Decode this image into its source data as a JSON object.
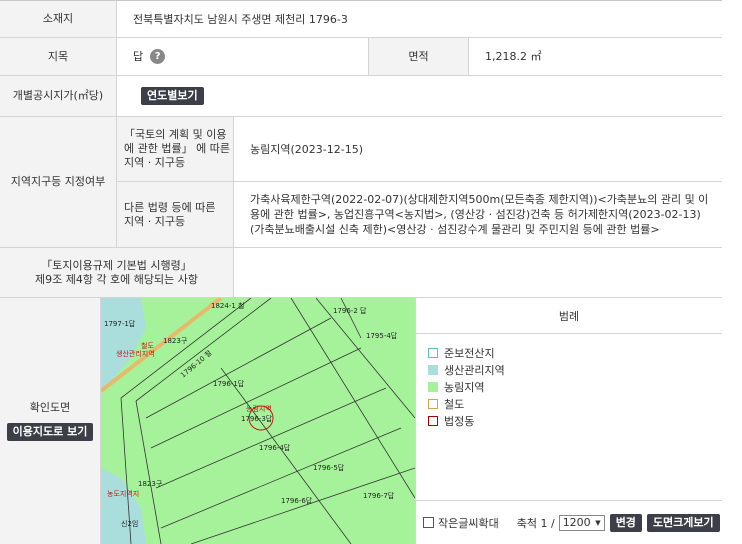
{
  "location": {
    "label": "소재지",
    "value": "전북특별자치도 남원시 주생면 제천리 1796-3"
  },
  "jimok": {
    "label": "지목",
    "value": "답",
    "help": "?"
  },
  "area": {
    "label": "면적",
    "value": "1,218.2 ㎡"
  },
  "price": {
    "label": "개별공시지가(㎡당)",
    "button": "연도별보기"
  },
  "zones": {
    "label": "지역지구등 지정여부",
    "national_label": "「국토의 계획 및 이용\n에 관한 법률」 에 따른\n지역 · 지구등",
    "national_value": "농림지역(2023-12-15)",
    "other_label": "다른 법령 등에 따른\n지역 · 지구등",
    "other_value": "가축사육제한구역(2022-02-07)(상대제한지역500m(모든축종 제한지역))<가축분뇨의 관리 및 이용에 관한 법률>, 농업진흥구역<농지법>, (영산강 · 섬진강)건축 등 허가제한지역(2023-02-13)(가축분뇨배출시설 신축 제한)<영산강 · 섬진강수계 물관리 및 주민지원 등에 관한 법률>"
  },
  "regulation": {
    "label": "「토지이용규제 기본법 시행령」\n제9조 제4항 각 호에 해당되는 사항",
    "value": ""
  },
  "map": {
    "label": "확인도면",
    "button": "이용지도로 보기",
    "labels": {
      "p1824": "1824-1 철",
      "p1797": "1797-1답",
      "p1823": "1823구",
      "rail": "철도",
      "prod_zone": "생산관리지역",
      "p1796_10": "1796-10 철",
      "p1796_1": "1796-1답",
      "p1796_2": "1796-2 답",
      "p1795_4": "1795-4답",
      "farm_zone": "농림지역",
      "p1796_3": "1796-3답",
      "p1796_4": "1796-4답",
      "p1796_5": "1796-5답",
      "p1796_6": "1796-6답",
      "p1796_7": "1796-7답",
      "p1822": "신2임",
      "dong": "농도지역지"
    },
    "colors": {
      "farm": "#a6f29a",
      "prod": "#a9dedd",
      "rail": "#e8b86b",
      "boundary": "#c11"
    }
  },
  "legend": {
    "title": "범례",
    "items": [
      {
        "label": "준보전산지",
        "fill": "#ffffff",
        "border": "#6bb"
      },
      {
        "label": "생산관리지역",
        "fill": "#a9dedd",
        "border": "#a9dedd"
      },
      {
        "label": "농림지역",
        "fill": "#a6f29a",
        "border": "#a6f29a"
      },
      {
        "label": "철도",
        "fill": "#ffffff",
        "border": "#d9a24a"
      },
      {
        "label": "법정동",
        "fill": "#ffffff",
        "border": "#a00"
      }
    ]
  },
  "controls": {
    "small_text_label": "작은글씨확대",
    "scale_label": "축척 1 /",
    "scale_value": "1200",
    "change_button": "변경",
    "enlarge_button": "도면크게보기"
  }
}
